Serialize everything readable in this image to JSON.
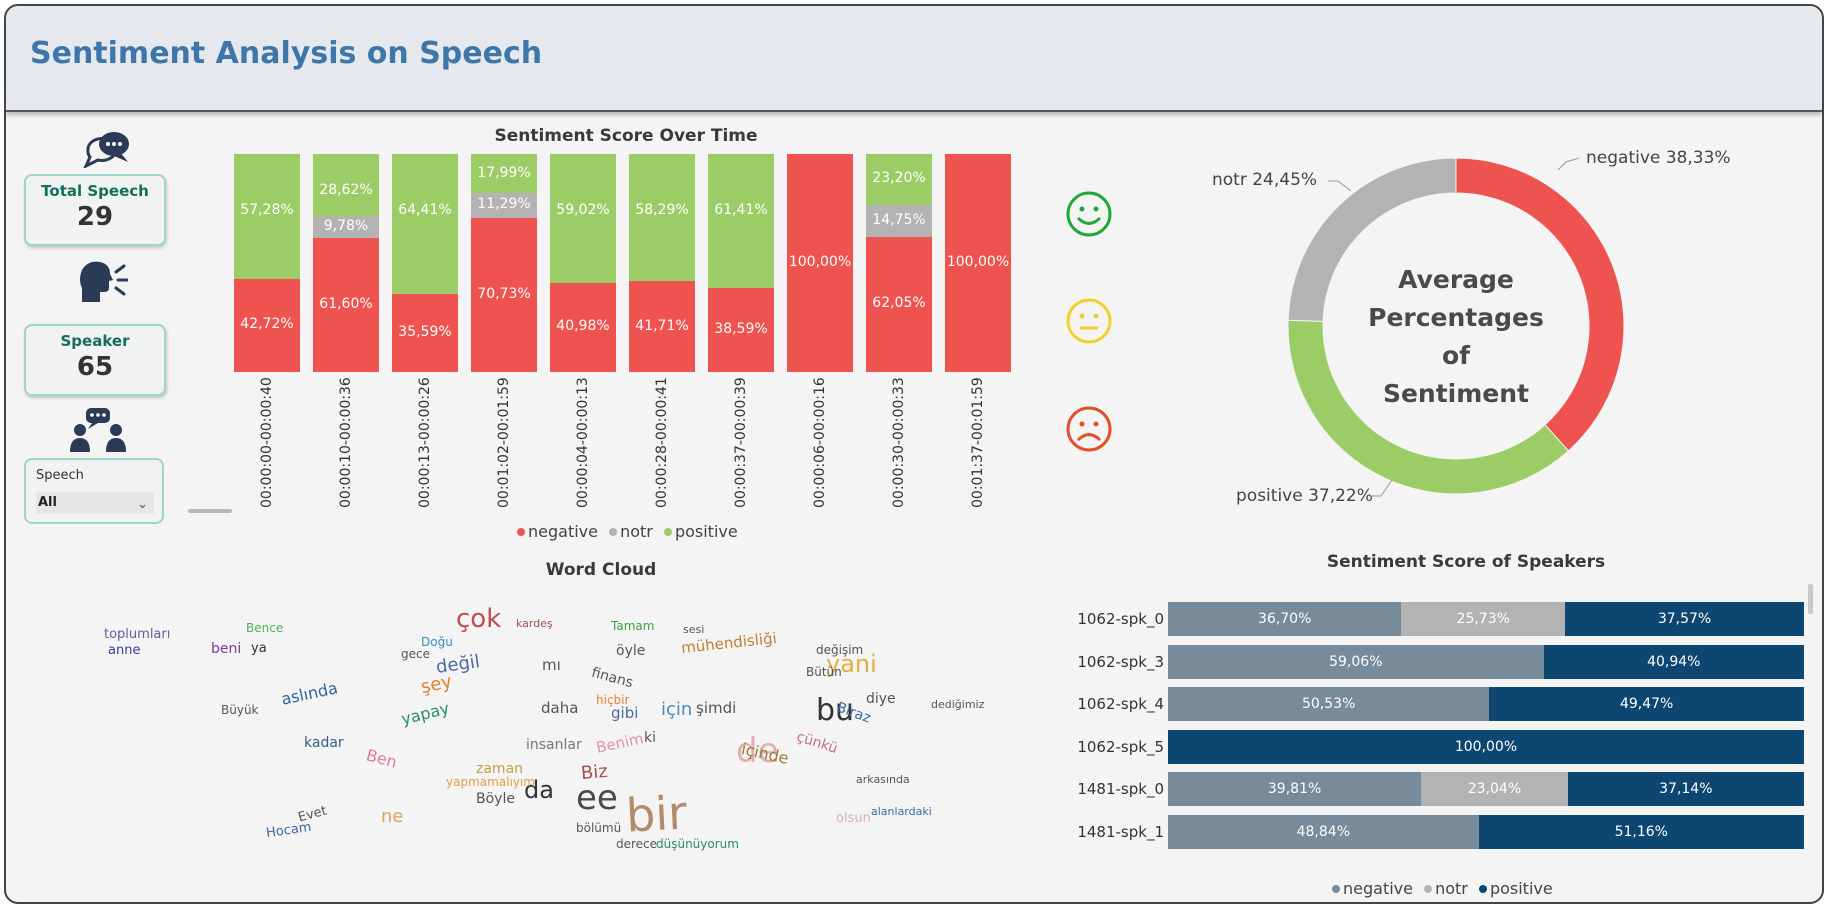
{
  "header": {
    "title": "Sentiment Analysis on Speech"
  },
  "kpis": {
    "total_speech_label": "Total Speech",
    "total_speech_value": "29",
    "speaker_label": "Speaker",
    "speaker_value": "65"
  },
  "slicer": {
    "label": "Speech",
    "selected": "All"
  },
  "colors": {
    "negative": "#ef5350",
    "notr": "#b3b3b3",
    "positive": "#9ccc65",
    "speaker_negative": "#778b9a",
    "speaker_notr": "#b3b3b3",
    "speaker_positive": "#0d4771"
  },
  "icons": [
    "speech-bubble-icon",
    "speaking-person-icon",
    "group-chat-icon",
    "happy-face-icon",
    "neutral-face-icon",
    "sad-face-icon"
  ],
  "chart_data": [
    {
      "type": "bar",
      "stacked": "percent",
      "title": "Sentiment Score Over Time",
      "categories": [
        "00:00:00-00:00:40",
        "00:00:10-00:00:36",
        "00:00:13-00:00:26",
        "00:01:02-00:01:59",
        "00:00:04-00:00:13",
        "00:00:28-00:00:41",
        "00:00:37-00:00:39",
        "00:00:06-00:00:16",
        "00:00:30-00:00:33",
        "00:01:37-00:01:59"
      ],
      "series": [
        {
          "name": "negative",
          "values": [
            42.72,
            61.6,
            35.59,
            70.73,
            40.98,
            41.71,
            38.59,
            100.0,
            62.05,
            100.0
          ],
          "labels": [
            "42,72%",
            "61,60%",
            "35,59%",
            "70,73%",
            "40,98%",
            "41,71%",
            "38,59%",
            "100,00%",
            "62,05%",
            "100,00%"
          ]
        },
        {
          "name": "notr",
          "values": [
            0,
            9.78,
            0,
            11.29,
            0,
            0,
            0,
            0,
            14.75,
            0
          ],
          "labels": [
            "",
            "9,78%",
            "",
            "11,29%",
            "",
            "",
            "",
            "",
            "14,75%",
            ""
          ]
        },
        {
          "name": "positive",
          "values": [
            57.28,
            28.62,
            64.41,
            17.99,
            59.02,
            58.29,
            61.41,
            0,
            23.2,
            0
          ],
          "labels": [
            "57,28%",
            "28,62%",
            "64,41%",
            "17,99%",
            "59,02%",
            "58,29%",
            "61,41%",
            "",
            "23,20%",
            ""
          ]
        }
      ],
      "legend": [
        "negative",
        "notr",
        "positive"
      ],
      "legend_position": "bottom"
    },
    {
      "type": "pie",
      "donut": true,
      "title": "",
      "center_text": "Average Percentages of Sentiment",
      "labels": [
        "negative",
        "positive",
        "notr"
      ],
      "values": [
        38.33,
        37.22,
        24.45
      ],
      "data_labels": [
        "negative 38,33%",
        "positive 37,22%",
        "notr 24,45%"
      ]
    },
    {
      "type": "bar",
      "orientation": "horizontal",
      "stacked": "percent",
      "title": "Sentiment Score of Speakers",
      "categories": [
        "1062-spk_0",
        "1062-spk_3",
        "1062-spk_4",
        "1062-spk_5",
        "1481-spk_0",
        "1481-spk_1"
      ],
      "series": [
        {
          "name": "negative",
          "values": [
            36.7,
            59.06,
            50.53,
            0,
            39.81,
            48.84
          ],
          "labels": [
            "36,70%",
            "59,06%",
            "50,53%",
            "",
            "39,81%",
            "48,84%"
          ]
        },
        {
          "name": "notr",
          "values": [
            25.73,
            0,
            0,
            0,
            23.04,
            0
          ],
          "labels": [
            "25,73%",
            "",
            "",
            "",
            "23,04%",
            ""
          ]
        },
        {
          "name": "positive",
          "values": [
            37.57,
            40.94,
            49.47,
            100.0,
            37.14,
            51.16
          ],
          "labels": [
            "37,57%",
            "40,94%",
            "49,47%",
            "100,00%",
            "37,14%",
            "51,16%"
          ]
        }
      ],
      "legend": [
        "negative",
        "notr",
        "positive"
      ],
      "legend_position": "bottom"
    }
  ],
  "word_cloud": {
    "title": "Word Cloud",
    "words": [
      {
        "t": "bir",
        "s": 46,
        "c": "#b08d6a"
      },
      {
        "t": "ee",
        "s": 34,
        "c": "#4a4a4a"
      },
      {
        "t": "de",
        "s": 34,
        "c": "#e0b0b0"
      },
      {
        "t": "bu",
        "s": 30,
        "c": "#333333"
      },
      {
        "t": "çok",
        "s": 26,
        "c": "#c0504d"
      },
      {
        "t": "yani",
        "s": 24,
        "c": "#e0b040"
      },
      {
        "t": "da",
        "s": 24,
        "c": "#333333"
      },
      {
        "t": "değil",
        "s": 18,
        "c": "#4a6aa0"
      },
      {
        "t": "şey",
        "s": 18,
        "c": "#e08030"
      },
      {
        "t": "Biz",
        "s": 18,
        "c": "#a05050"
      },
      {
        "t": "için",
        "s": 18,
        "c": "#4a8ac0"
      },
      {
        "t": "ne",
        "s": 18,
        "c": "#e0a060"
      },
      {
        "t": "aslında",
        "s": 16,
        "c": "#3060a0"
      },
      {
        "t": "yapay",
        "s": 16,
        "c": "#2a8a6a"
      },
      {
        "t": "mühendisliği",
        "s": 15,
        "c": "#c08030"
      },
      {
        "t": "içinde",
        "s": 16,
        "c": "#9a7a3a"
      },
      {
        "t": "Ben",
        "s": 16,
        "c": "#e07a9a"
      },
      {
        "t": "Benim",
        "s": 15,
        "c": "#e090b0"
      },
      {
        "t": "daha",
        "s": 15,
        "c": "#555555"
      },
      {
        "t": "finans",
        "s": 14,
        "c": "#555555"
      },
      {
        "t": "toplumları",
        "s": 13,
        "c": "#6060a0"
      },
      {
        "t": "anne",
        "s": 13,
        "c": "#3a3aa0"
      },
      {
        "t": "Bence",
        "s": 12,
        "c": "#50b050"
      },
      {
        "t": "beni",
        "s": 14,
        "c": "#7a3a9a"
      },
      {
        "t": "ya",
        "s": 13,
        "c": "#333333"
      },
      {
        "t": "Tamam",
        "s": 12,
        "c": "#40a040"
      },
      {
        "t": "öyle",
        "s": 14,
        "c": "#555555"
      },
      {
        "t": "kardeş",
        "s": 11,
        "c": "#a05050"
      },
      {
        "t": "zaman",
        "s": 14,
        "c": "#c0a040"
      },
      {
        "t": "gibi",
        "s": 15,
        "c": "#4a6aa0"
      },
      {
        "t": "kadar",
        "s": 14,
        "c": "#3a5a8a"
      },
      {
        "t": "Böyle",
        "s": 14,
        "c": "#555555"
      },
      {
        "t": "insanlar",
        "s": 14,
        "c": "#777777"
      },
      {
        "t": "yapmamalıyım",
        "s": 12,
        "c": "#e0a040"
      },
      {
        "t": "mı",
        "s": 15,
        "c": "#555555"
      },
      {
        "t": "ki",
        "s": 14,
        "c": "#555555"
      },
      {
        "t": "şimdi",
        "s": 15,
        "c": "#555555"
      },
      {
        "t": "Biraz",
        "s": 14,
        "c": "#3a6aa0"
      },
      {
        "t": "diye",
        "s": 14,
        "c": "#555555"
      },
      {
        "t": "çünkü",
        "s": 14,
        "c": "#c07090"
      },
      {
        "t": "hiçbir",
        "s": 12,
        "c": "#e08030"
      },
      {
        "t": "Büyük",
        "s": 12,
        "c": "#555555"
      },
      {
        "t": "değişim",
        "s": 12,
        "c": "#555555"
      },
      {
        "t": "Bütün",
        "s": 12,
        "c": "#555555"
      },
      {
        "t": "dediğimiz",
        "s": 11,
        "c": "#555555"
      },
      {
        "t": "arkasında",
        "s": 11,
        "c": "#555555"
      },
      {
        "t": "alanlardaki",
        "s": 11,
        "c": "#3a6aa0"
      },
      {
        "t": "Hocam",
        "s": 13,
        "c": "#3a6aa0"
      },
      {
        "t": "Evet",
        "s": 13,
        "c": "#555555"
      },
      {
        "t": "olsun",
        "s": 13,
        "c": "#e0b0b0"
      },
      {
        "t": "düşünüyorum",
        "s": 12,
        "c": "#2a8a6a"
      },
      {
        "t": "bölümü",
        "s": 12,
        "c": "#555555"
      },
      {
        "t": "derece",
        "s": 12,
        "c": "#555555"
      },
      {
        "t": "gece",
        "s": 12,
        "c": "#555555"
      },
      {
        "t": "Doğu",
        "s": 12,
        "c": "#3a8ac0"
      },
      {
        "t": "sesi",
        "s": 11,
        "c": "#555555"
      }
    ]
  },
  "scrollbar": {
    "label": "horizontal-scrollbar"
  }
}
